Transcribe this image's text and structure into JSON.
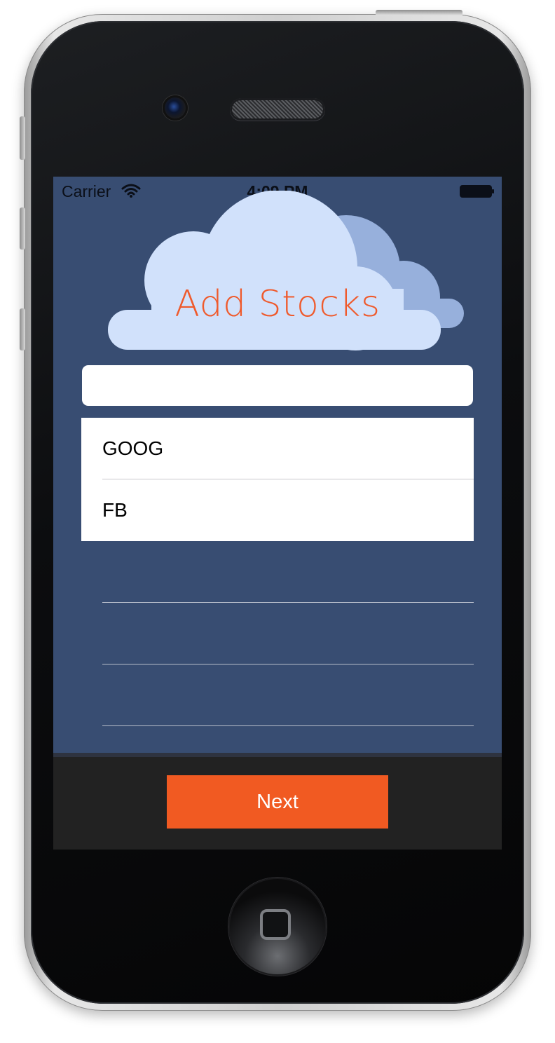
{
  "status_bar": {
    "carrier": "Carrier",
    "time": "4:09 PM",
    "wifi_icon": "wifi-icon",
    "battery_icon": "battery-icon"
  },
  "header": {
    "title": "Add Stocks",
    "title_color": "#ef5a2c",
    "cloud_front_color": "#d1e1fb",
    "cloud_back_color": "#97b0dc"
  },
  "search": {
    "value": "",
    "placeholder": ""
  },
  "stocks": {
    "items": [
      {
        "symbol": "GOOG"
      },
      {
        "symbol": "FB"
      }
    ]
  },
  "footer": {
    "next_label": "Next",
    "button_color": "#f15a22"
  },
  "colors": {
    "screen_background": "#384d72",
    "footer_background": "#222222"
  }
}
